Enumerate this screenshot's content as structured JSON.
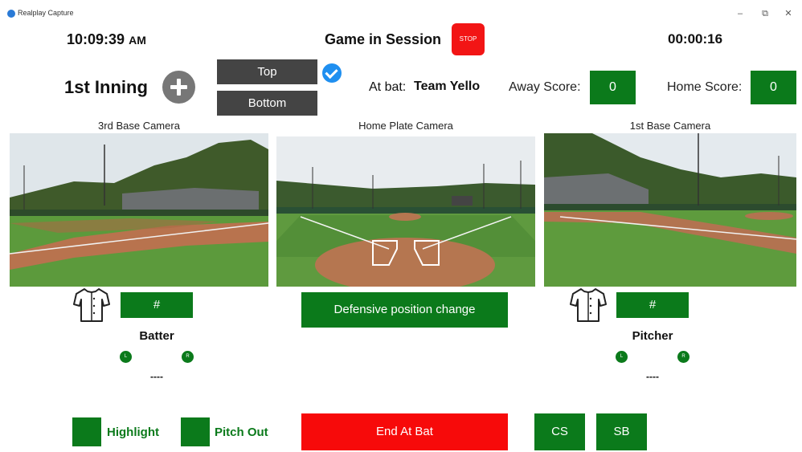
{
  "window": {
    "title": "Realplay Capture",
    "minimize": "–",
    "restore": "⧉",
    "close": "✕"
  },
  "header": {
    "clock_time": "10:09:39",
    "clock_ampm": "AM",
    "session_status": "Game in Session",
    "stop_label": "STOP",
    "elapsed": "00:00:16"
  },
  "inning": {
    "label": "1st Inning",
    "top_label": "Top",
    "bottom_label": "Bottom",
    "selected": "Top"
  },
  "at_bat": {
    "label": "At bat:",
    "team": "Team Yello"
  },
  "scores": {
    "away_label": "Away Score:",
    "away_value": "0",
    "home_label": "Home Score:",
    "home_value": "0"
  },
  "cameras": [
    {
      "label": "3rd Base Camera"
    },
    {
      "label": "Home Plate Camera"
    },
    {
      "label": "1st Base Camera"
    }
  ],
  "batter": {
    "number_label": "#",
    "role": "Batter",
    "left": "L",
    "right": "R",
    "name": "----"
  },
  "pitcher": {
    "number_label": "#",
    "role": "Pitcher",
    "left": "L",
    "right": "R",
    "name": "----"
  },
  "defensive_change_label": "Defensive position change",
  "bottom_bar": {
    "highlight_label": "Highlight",
    "pitch_out_label": "Pitch Out",
    "end_at_bat_label": "End At Bat",
    "cs_label": "CS",
    "sb_label": "SB"
  },
  "colors": {
    "accent_green": "#0b7a1b",
    "stop_red": "#f21515",
    "toggle_dark": "#444444",
    "check_blue": "#1f8ff0"
  }
}
